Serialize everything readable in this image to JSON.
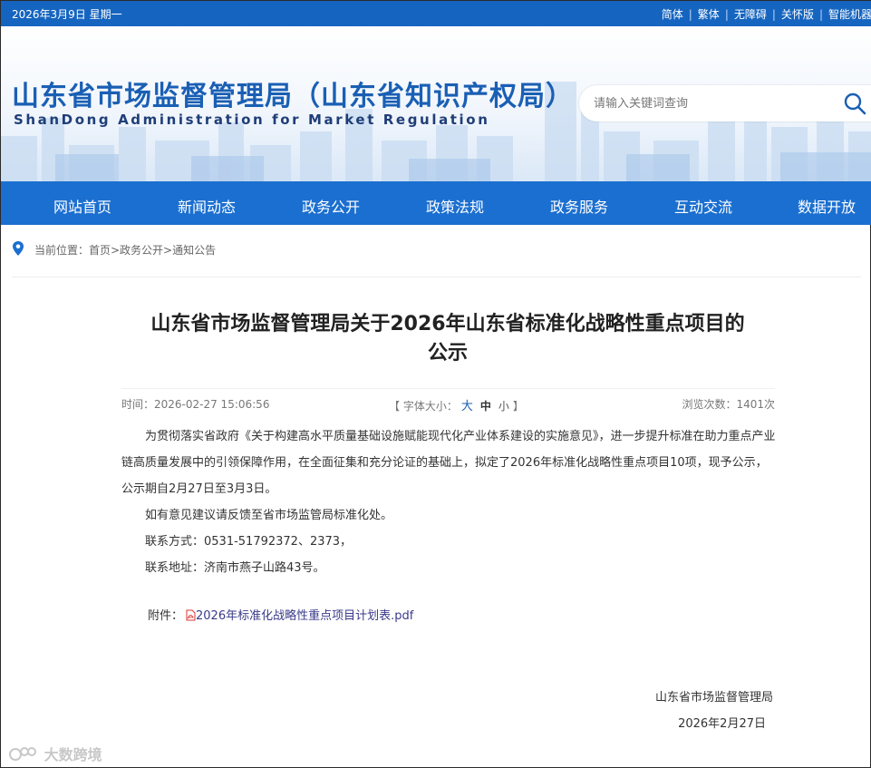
{
  "topbar": {
    "date": "2026年3月9日 星期一",
    "links": [
      "简体",
      "繁体",
      "无障碍",
      "关怀版",
      "智能机器"
    ]
  },
  "header": {
    "title": "山东省市场监督管理局（山东省知识产权局）",
    "subtitle": "ShanDong Administration for Market Regulation",
    "search_placeholder": "请输入关键词查询"
  },
  "nav": {
    "items": [
      "网站首页",
      "新闻动态",
      "政务公开",
      "政策法规",
      "政务服务",
      "互动交流",
      "数据开放"
    ]
  },
  "breadcrumb": "当前位置：首页>政务公开>通知公告",
  "article": {
    "title_line1": "山东省市场监督管理局关于2026年山东省标准化战略性重点项目的",
    "title_line2": "公示",
    "time": "时间：2026-02-27 15:06:56",
    "font_label_left": "【 字体大小：",
    "font_big": "大",
    "font_mid": "中",
    "font_small": "小",
    "font_label_right": "】",
    "views": "浏览次数：1401次",
    "paragraphs": [
      "为贯彻落实省政府《关于构建高水平质量基础设施赋能现代化产业体系建设的实施意见》，进一步提升标准在助力重点产业链高质量发展中的引领保障作用，在全面征集和充分论证的基础上，拟定了2026年标准化战略性重点项目10项，现予公示，公示期自2月27日至3月3日。",
      "如有意见建议请反馈至省市场监管局标准化处。",
      "联系方式：0531-51792372、2373，",
      "联系地址：济南市燕子山路43号。"
    ],
    "attachment_label": "附件：",
    "attachment_name": "2026年标准化战略性重点项目计划表.pdf",
    "signature_org": "山东省市场监督管理局",
    "signature_date": "2026年2月27日"
  },
  "watermark": "大数跨境",
  "colors": {
    "topbar": "#1565c0",
    "nav": "#1b6fd0",
    "title_blue": "#1a5fb4"
  }
}
